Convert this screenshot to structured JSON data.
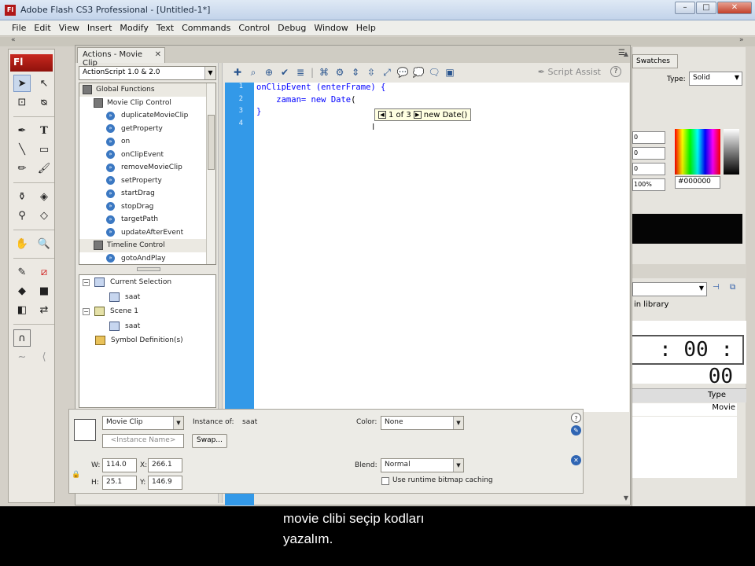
{
  "titlebar": {
    "app_icon": "Fl",
    "title": "Adobe Flash CS3 Professional - [Untitled-1*]",
    "buttons": [
      "–",
      "□",
      "✕"
    ]
  },
  "menubar": [
    "File",
    "Edit",
    "View",
    "Insert",
    "Modify",
    "Text",
    "Commands",
    "Control",
    "Debug",
    "Window",
    "Help"
  ],
  "tools": {
    "logo": "Fl",
    "icons": [
      "arrow-tool-icon",
      "subselect-tool-icon",
      "free-transform-icon",
      "lasso-icon",
      "pen-tool-icon",
      "text-tool-icon",
      "line-tool-icon",
      "rectangle-tool-icon",
      "pencil-tool-icon",
      "brush-tool-icon",
      "ink-bottle-icon",
      "paint-bucket-icon",
      "eyedropper-icon",
      "eraser-icon",
      "hand-tool-icon",
      "zoom-tool-icon",
      "stroke-color-icon",
      "fill-color-icon",
      "black-white-icon",
      "swap-colors-icon",
      "snap-magnet-icon",
      "smooth-icon",
      "straighten-icon"
    ]
  },
  "actions_panel": {
    "tab_title": "Actions - Movie Clip",
    "as_version": "ActionScript 1.0 & 2.0",
    "toolbox": [
      {
        "kind": "folder",
        "label": "Global Functions"
      },
      {
        "kind": "book",
        "label": "Movie Clip Control"
      },
      {
        "kind": "item",
        "label": "duplicateMovieClip"
      },
      {
        "kind": "item",
        "label": "getProperty"
      },
      {
        "kind": "item",
        "label": "on"
      },
      {
        "kind": "item",
        "label": "onClipEvent"
      },
      {
        "kind": "item",
        "label": "removeMovieClip"
      },
      {
        "kind": "item",
        "label": "setProperty"
      },
      {
        "kind": "item",
        "label": "startDrag"
      },
      {
        "kind": "item",
        "label": "stopDrag"
      },
      {
        "kind": "item",
        "label": "targetPath"
      },
      {
        "kind": "item",
        "label": "updateAfterEvent"
      },
      {
        "kind": "book",
        "label": "Timeline Control"
      },
      {
        "kind": "item",
        "label": "gotoAndPlay"
      }
    ],
    "navigator": {
      "current_selection": "Current Selection",
      "saat_1": "saat",
      "scene": "Scene 1",
      "saat_2": "saat",
      "symbol_definitions": "Symbol Definition(s)"
    },
    "script_assist": "Script Assist",
    "line_numbers": [
      "1",
      "2",
      "3",
      "4"
    ],
    "code": {
      "line1": "onClipEvent (enterFrame) {",
      "line2_a": "    zaman= new Date",
      "line2_b": "(",
      "line3": "}",
      "line4": ""
    },
    "code_hint": {
      "counter": "1 of 3",
      "text": "new Date()"
    }
  },
  "right_panels": {
    "swatches_tab": "Swatches",
    "type_label": "Type:",
    "type_value": "Solid",
    "color_fields": [
      "0",
      "0",
      "0",
      "100%"
    ],
    "hex": "#000000",
    "in_library": "in library",
    "clock_text": ":  00 : 00",
    "type_col": "Type",
    "movie_cell": "Movie"
  },
  "properties": {
    "symbol_type": "Movie Clip",
    "instance_name_placeholder": "<Instance Name>",
    "instance_of_label": "Instance of:",
    "instance_of_value": "saat",
    "swap_button": "Swap...",
    "color_label": "Color:",
    "color_value": "None",
    "blend_label": "Blend:",
    "blend_value": "Normal",
    "bitmap_caching": "Use runtime bitmap caching",
    "w_label": "W:",
    "w_value": "114.0",
    "x_label": "X:",
    "x_value": "266.1",
    "h_label": "H:",
    "h_value": "25.1",
    "y_label": "Y:",
    "y_value": "146.9"
  },
  "subtitle": {
    "line1": "movie clibi seçip kodları",
    "line2": "yazalım."
  }
}
